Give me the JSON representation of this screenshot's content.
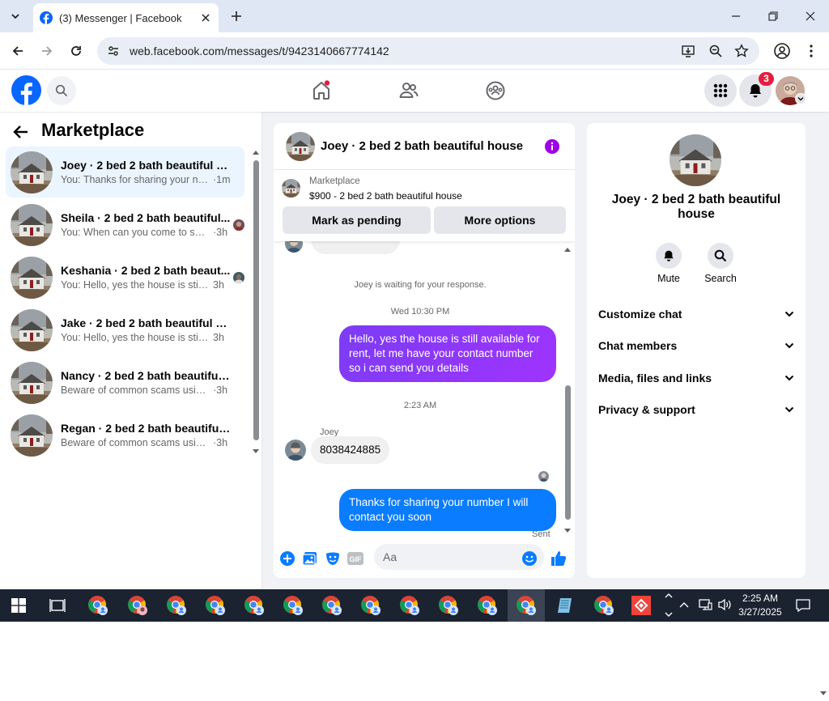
{
  "browser": {
    "tab_title": "(3) Messenger | Facebook",
    "url": "web.facebook.com/messages/t/9423140667774142"
  },
  "header": {
    "notification_count": "3"
  },
  "sidebar": {
    "title": "Marketplace",
    "conversations": [
      {
        "name": "Joey · 2 bed 2 bath beautiful ho...",
        "preview": "You: Thanks for sharing your num...",
        "time": "·1m",
        "active": true
      },
      {
        "name": "Sheila · 2 bed 2 bath beautiful...",
        "preview": "You: When can you come to see...",
        "time": "·3h"
      },
      {
        "name": "Keshania · 2 bed 2 bath beaut...",
        "preview": "You: Hello, yes the house is still ...",
        "time": "3h"
      },
      {
        "name": "Jake · 2 bed 2 bath beautiful ho...",
        "preview": "You: Hello, yes the house is still ava...",
        "time": "3h"
      },
      {
        "name": "Nancy · 2 bed 2 bath beautiful h...",
        "preview": "Beware of common scams using p...",
        "time": "·3h"
      },
      {
        "name": "Regan · 2 bed 2 bath beautiful h...",
        "preview": "Beware of common scams using p...",
        "time": "·3h"
      }
    ]
  },
  "chat": {
    "title": "Joey · 2 bed 2 bath beautiful house",
    "listing_category": "Marketplace",
    "listing_price_title": "$900 - 2 bed 2 bath beautiful house",
    "mark_pending_label": "Mark as pending",
    "more_options_label": "More options",
    "waiting_text": "Joey is waiting for your response.",
    "timestamp_1": "Wed 10:30 PM",
    "message_1": "Hello, yes the house is still available for rent, let me have your contact number so i can send you  details",
    "timestamp_2": "2:23 AM",
    "sender_name": "Joey",
    "message_2": "8038424885",
    "message_3": "Thanks for sharing your number I will contact you soon",
    "status": "Sent",
    "input_placeholder": "Aa"
  },
  "details": {
    "name": "Joey · 2 bed 2 bath beautiful house",
    "mute_label": "Mute",
    "search_label": "Search",
    "sections": [
      "Customize chat",
      "Chat members",
      "Media, files and links",
      "Privacy & support"
    ]
  },
  "taskbar": {
    "time": "2:25 AM",
    "date": "3/27/2025"
  },
  "colors": {
    "facebook_blue": "#0866ff",
    "messenger_blue": "#0a7cff",
    "messenger_purple": "#8a3ffc",
    "notification_red": "#e41e3f"
  }
}
